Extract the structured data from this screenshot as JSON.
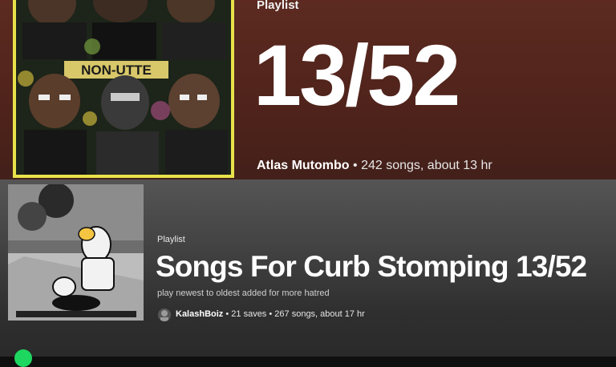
{
  "top": {
    "label": "Playlist",
    "title": "13/52",
    "owner": "Atlas Mutombo",
    "separator": "•",
    "details": "242 songs, about 13 hr",
    "cover_text": "NON-UTTE"
  },
  "bottom": {
    "label": "Playlist",
    "title": "Songs For Curb Stomping 13/52",
    "description": "play newest to oldest added for more hatred",
    "owner": "KalashBoiz",
    "separator": "•",
    "saves": "21 saves",
    "details": "267 songs, about 17 hr"
  },
  "colors": {
    "top_bg": "#5c2a20",
    "bottom_bg": "#444444",
    "accent_green": "#1ed760"
  }
}
